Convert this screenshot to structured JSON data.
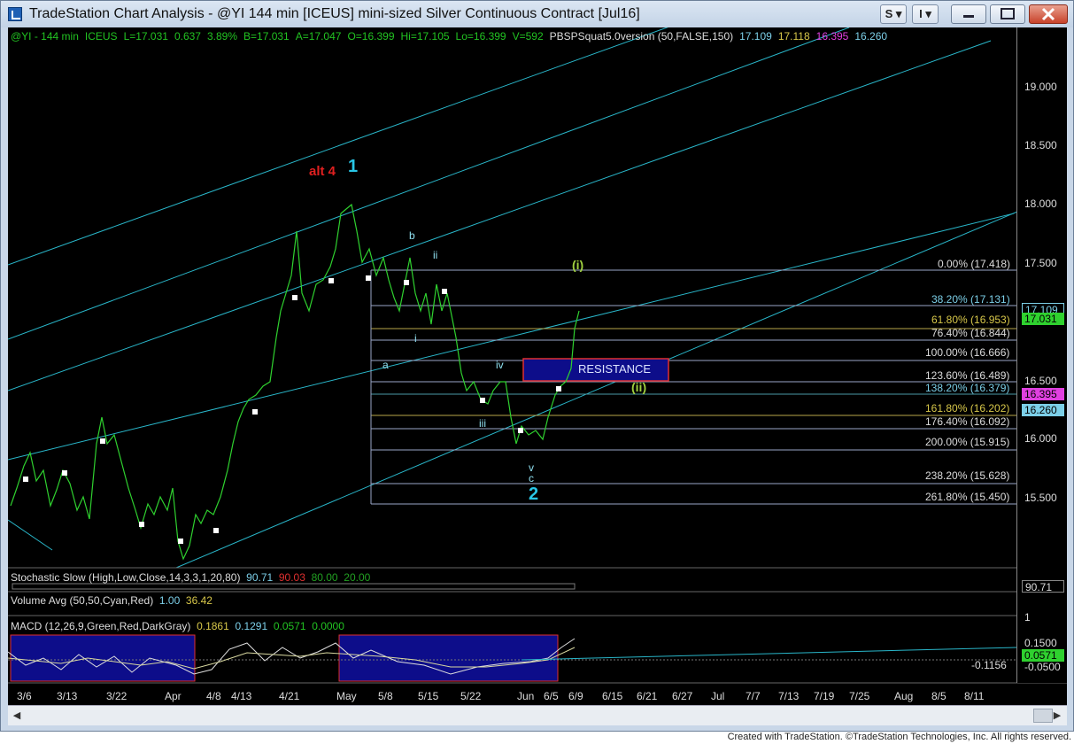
{
  "window": {
    "title": "TradeStation Chart Analysis - @YI 144 min [ICEUS] mini-sized Silver Continuous Contract [Jul16]",
    "btn_s": "S",
    "btn_i": "I"
  },
  "header": {
    "symbol": "@YI - 144 min",
    "exchange": "ICEUS",
    "last": "L=17.031",
    "chg": "0.637",
    "pct": "3.89%",
    "bid": "B=17.031",
    "ask": "A=17.047",
    "open": "O=16.399",
    "high": "Hi=17.105",
    "low": "Lo=16.399",
    "vol": "V=592",
    "study": "PBSPSquat5.0version (50,FALSE,150)",
    "v1": "17.109",
    "v2": "17.118",
    "v3": "16.395",
    "v4": "16.260"
  },
  "annotations": {
    "alt4": "alt 4",
    "one": "1",
    "two": "2",
    "b": "b",
    "ii": "ii",
    "i_small": "i",
    "a": "a",
    "iv": "iv",
    "iii": "iii",
    "v": "v",
    "c": "c",
    "wave_i": "(i)",
    "wave_ii": "(ii)",
    "resistance": "RESISTANCE"
  },
  "fib_levels": [
    "0.00% (17.418)",
    "38.20% (17.131)",
    "61.80% (16.953)",
    "76.40% (16.844)",
    "100.00% (16.666)",
    "123.60% (16.489)",
    "138.20% (16.379)",
    "161.80% (16.202)",
    "176.40% (16.092)",
    "200.00% (15.915)",
    "238.20% (15.628)",
    "261.80% (15.450)"
  ],
  "price_axis": [
    "19.000",
    "18.500",
    "18.000",
    "17.500",
    "17.000",
    "16.500",
    "16.000",
    "15.500"
  ],
  "price_tags": [
    "17.109",
    "17.031",
    "16.395",
    "16.260"
  ],
  "stochastic": {
    "name": "Stochastic Slow (High,Low,Close,14,3,3,1,20,80)",
    "v1": "90.71",
    "v2": "90.03",
    "v3": "80.00",
    "v4": "20.00",
    "tag": "90.71"
  },
  "volume": {
    "name": "Volume Avg (50,50,Cyan,Red)",
    "v1": "1.00",
    "v2": "36.42",
    "tag": "1"
  },
  "macd": {
    "name": "MACD (12,26,9,Green,Red,DarkGray)",
    "v1": "0.1861",
    "v2": "0.1291",
    "v3": "0.0571",
    "v4": "0.0000",
    "axis1": "0.1500",
    "tag": "0.0571",
    "axis2": "-0.0500",
    "neg": "-0.1156"
  },
  "dates": [
    "3/6",
    "3/13",
    "3/22",
    "Apr",
    "4/8",
    "4/13",
    "4/21",
    "May",
    "5/8",
    "5/15",
    "5/22",
    "Jun",
    "6/5",
    "6/9",
    "6/15",
    "6/21",
    "6/27",
    "Jul",
    "7/7",
    "7/13",
    "7/19",
    "7/25",
    "Aug",
    "8/5",
    "8/11"
  ],
  "footer": "Created with TradeStation. ©TradeStation Technologies, Inc. All rights reserved."
}
